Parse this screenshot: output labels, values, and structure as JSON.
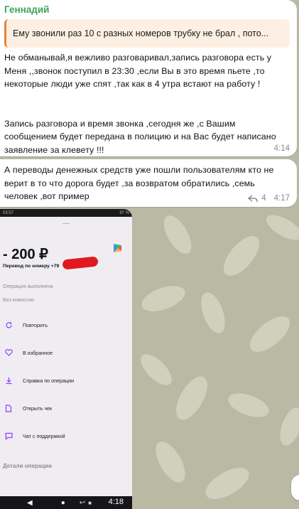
{
  "msg1": {
    "sender": "Геннадий",
    "reply_preview": "Ему звонили раз 10 с разных номеров трубку не брал , пото...",
    "text": "Не обманывай,я вежливо разговаривал,запись разговора есть у\nМеня ,,звонок поступил в 23:30 ,если Вы в это время пьете ,то\nнекоторые люди уже спят ,так как в 4 утра встают на работу !\n\n\nЗапись разговора и время звонка ,сегодня же ,с Вашим\nсообщением будет передана в полицию и на Вас будет написано\nзаявление за клевету !!!",
    "time": "4:14"
  },
  "msg2": {
    "text": "А переводы денежных средств уже пошли пользователям кто не\nверит в то что дорога будет ,за возвратом обратились ,семь\nчеловек ,вот пример",
    "reply_count": "4",
    "time": "4:17"
  },
  "photo": {
    "status_time": "03:57",
    "status_battery": "97 %",
    "amount": "- 200 ₽",
    "subtitle": "Перевод по номеру +79",
    "status_done": "Операция выполнена",
    "no_fee": "Без комиссии",
    "actions": [
      {
        "label": "Повторить",
        "icon": "repeat-icon"
      },
      {
        "label": "В избранное",
        "icon": "heart-icon"
      },
      {
        "label": "Справка по операции",
        "icon": "download-icon"
      },
      {
        "label": "Открыть чек",
        "icon": "document-icon"
      },
      {
        "label": "Чат с поддержкой",
        "icon": "chat-icon"
      }
    ],
    "details_label": "Детали операции",
    "time": "4:18"
  },
  "colors": {
    "sender": "#3ba55c",
    "reply_bar": "#e8823b",
    "reply_bg": "#fdf0e3",
    "chat_bg": "#bab9a3",
    "accent_purple": "#8a3ffc",
    "redaction": "#e0181f"
  }
}
